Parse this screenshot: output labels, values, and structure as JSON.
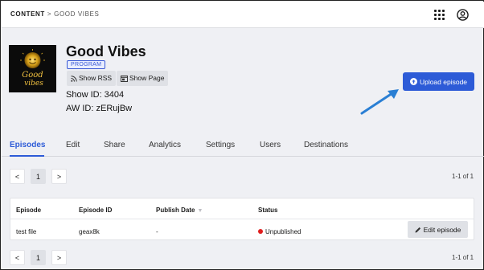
{
  "breadcrumb": {
    "root": "CONTENT",
    "separator": ">",
    "current": "GOOD VIBES"
  },
  "header_icons": {
    "apps": "apps-grid-icon",
    "account": "user-circle-icon"
  },
  "show": {
    "title": "Good Vibes",
    "type_badge": "PROGRAM",
    "cover_text": "Good vibes",
    "show_rss_label": "Show RSS",
    "show_page_label": "Show Page",
    "show_id_text": "Show ID: 3404",
    "aw_id_text": "AW ID: zERujBw"
  },
  "upload_label": "Upload episode",
  "tabs": [
    {
      "label": "Episodes",
      "active": true
    },
    {
      "label": "Edit"
    },
    {
      "label": "Share"
    },
    {
      "label": "Analytics"
    },
    {
      "label": "Settings"
    },
    {
      "label": "Users"
    },
    {
      "label": "Destinations"
    }
  ],
  "pagination": {
    "prev": "<",
    "page": "1",
    "next": ">",
    "range": "1-1 of 1"
  },
  "table": {
    "columns": [
      "Episode",
      "Episode ID",
      "Publish Date",
      "Status"
    ],
    "rows": [
      {
        "episode": "test file",
        "episode_id": "geax8k",
        "publish_date": "-",
        "status": "Unpublished",
        "action": "Edit episode"
      }
    ]
  },
  "colors": {
    "accent": "#2d5bd7",
    "status_unpublished": "#e01e1e",
    "background": "#eff0f4"
  }
}
